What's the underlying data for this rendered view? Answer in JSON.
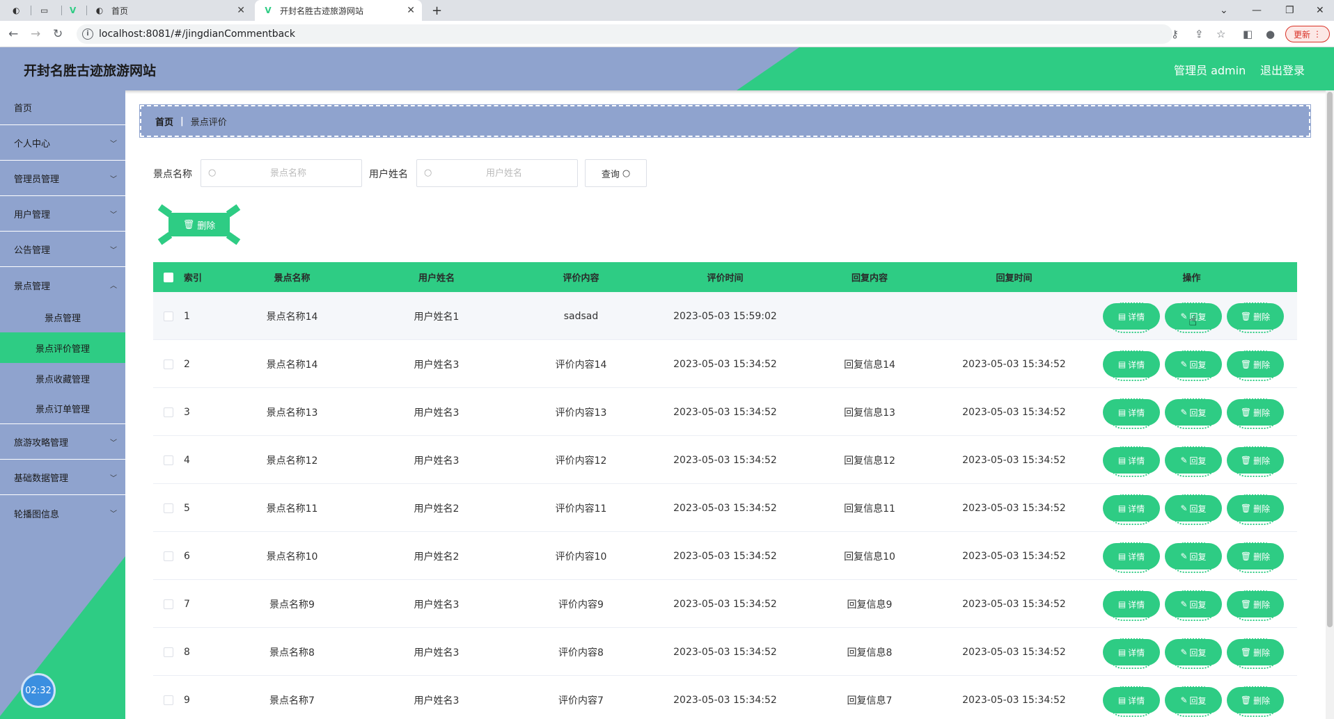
{
  "browser": {
    "tabs": [
      {
        "title": "首页"
      },
      {
        "title": "开封名胜古迹旅游网站"
      }
    ],
    "url": "localhost:8081/#/jingdianCommentback",
    "update_label": "更新"
  },
  "app": {
    "title": "开封名胜古迹旅游网站",
    "user_label": "管理员 admin",
    "logout_label": "退出登录"
  },
  "sidebar": {
    "items": [
      {
        "label": "首页"
      },
      {
        "label": "个人中心"
      },
      {
        "label": "管理员管理"
      },
      {
        "label": "用户管理"
      },
      {
        "label": "公告管理"
      },
      {
        "label": "景点管理"
      },
      {
        "label": "旅游攻略管理"
      },
      {
        "label": "基础数据管理"
      },
      {
        "label": "轮播图信息"
      }
    ],
    "sub_items": [
      {
        "label": "景点管理"
      },
      {
        "label": "景点评价管理"
      },
      {
        "label": "景点收藏管理"
      },
      {
        "label": "景点订单管理"
      }
    ],
    "clock": "02:32"
  },
  "breadcrumb": {
    "home": "首页",
    "separator": "|",
    "current": "景点评价"
  },
  "search": {
    "name_label": "景点名称",
    "name_placeholder": "景点名称",
    "user_label": "用户姓名",
    "user_placeholder": "用户姓名",
    "query_label": "查询"
  },
  "batch_delete_label": "删除",
  "table": {
    "headers": [
      "索引",
      "景点名称",
      "用户姓名",
      "评价内容",
      "评价时间",
      "回复内容",
      "回复时间",
      "操作"
    ],
    "actions": {
      "detail": "详情",
      "reply": "回复",
      "delete": "删除"
    },
    "rows": [
      {
        "index": "1",
        "name": "景点名称14",
        "user": "用户姓名1",
        "content": "sadsad",
        "time": "2023-05-03 15:59:02",
        "reply": "",
        "reply_time": ""
      },
      {
        "index": "2",
        "name": "景点名称14",
        "user": "用户姓名3",
        "content": "评价内容14",
        "time": "2023-05-03 15:34:52",
        "reply": "回复信息14",
        "reply_time": "2023-05-03 15:34:52"
      },
      {
        "index": "3",
        "name": "景点名称13",
        "user": "用户姓名3",
        "content": "评价内容13",
        "time": "2023-05-03 15:34:52",
        "reply": "回复信息13",
        "reply_time": "2023-05-03 15:34:52"
      },
      {
        "index": "4",
        "name": "景点名称12",
        "user": "用户姓名3",
        "content": "评价内容12",
        "time": "2023-05-03 15:34:52",
        "reply": "回复信息12",
        "reply_time": "2023-05-03 15:34:52"
      },
      {
        "index": "5",
        "name": "景点名称11",
        "user": "用户姓名2",
        "content": "评价内容11",
        "time": "2023-05-03 15:34:52",
        "reply": "回复信息11",
        "reply_time": "2023-05-03 15:34:52"
      },
      {
        "index": "6",
        "name": "景点名称10",
        "user": "用户姓名2",
        "content": "评价内容10",
        "time": "2023-05-03 15:34:52",
        "reply": "回复信息10",
        "reply_time": "2023-05-03 15:34:52"
      },
      {
        "index": "7",
        "name": "景点名称9",
        "user": "用户姓名3",
        "content": "评价内容9",
        "time": "2023-05-03 15:34:52",
        "reply": "回复信息9",
        "reply_time": "2023-05-03 15:34:52"
      },
      {
        "index": "8",
        "name": "景点名称8",
        "user": "用户姓名3",
        "content": "评价内容8",
        "time": "2023-05-03 15:34:52",
        "reply": "回复信息8",
        "reply_time": "2023-05-03 15:34:52"
      },
      {
        "index": "9",
        "name": "景点名称7",
        "user": "用户姓名3",
        "content": "评价内容7",
        "time": "2023-05-03 15:34:52",
        "reply": "回复信息7",
        "reply_time": "2023-05-03 15:34:52"
      }
    ]
  },
  "colors": {
    "green": "#2ecc84",
    "blue_gray": "#8fa3ce",
    "clock_blue": "#3b8fe0"
  }
}
